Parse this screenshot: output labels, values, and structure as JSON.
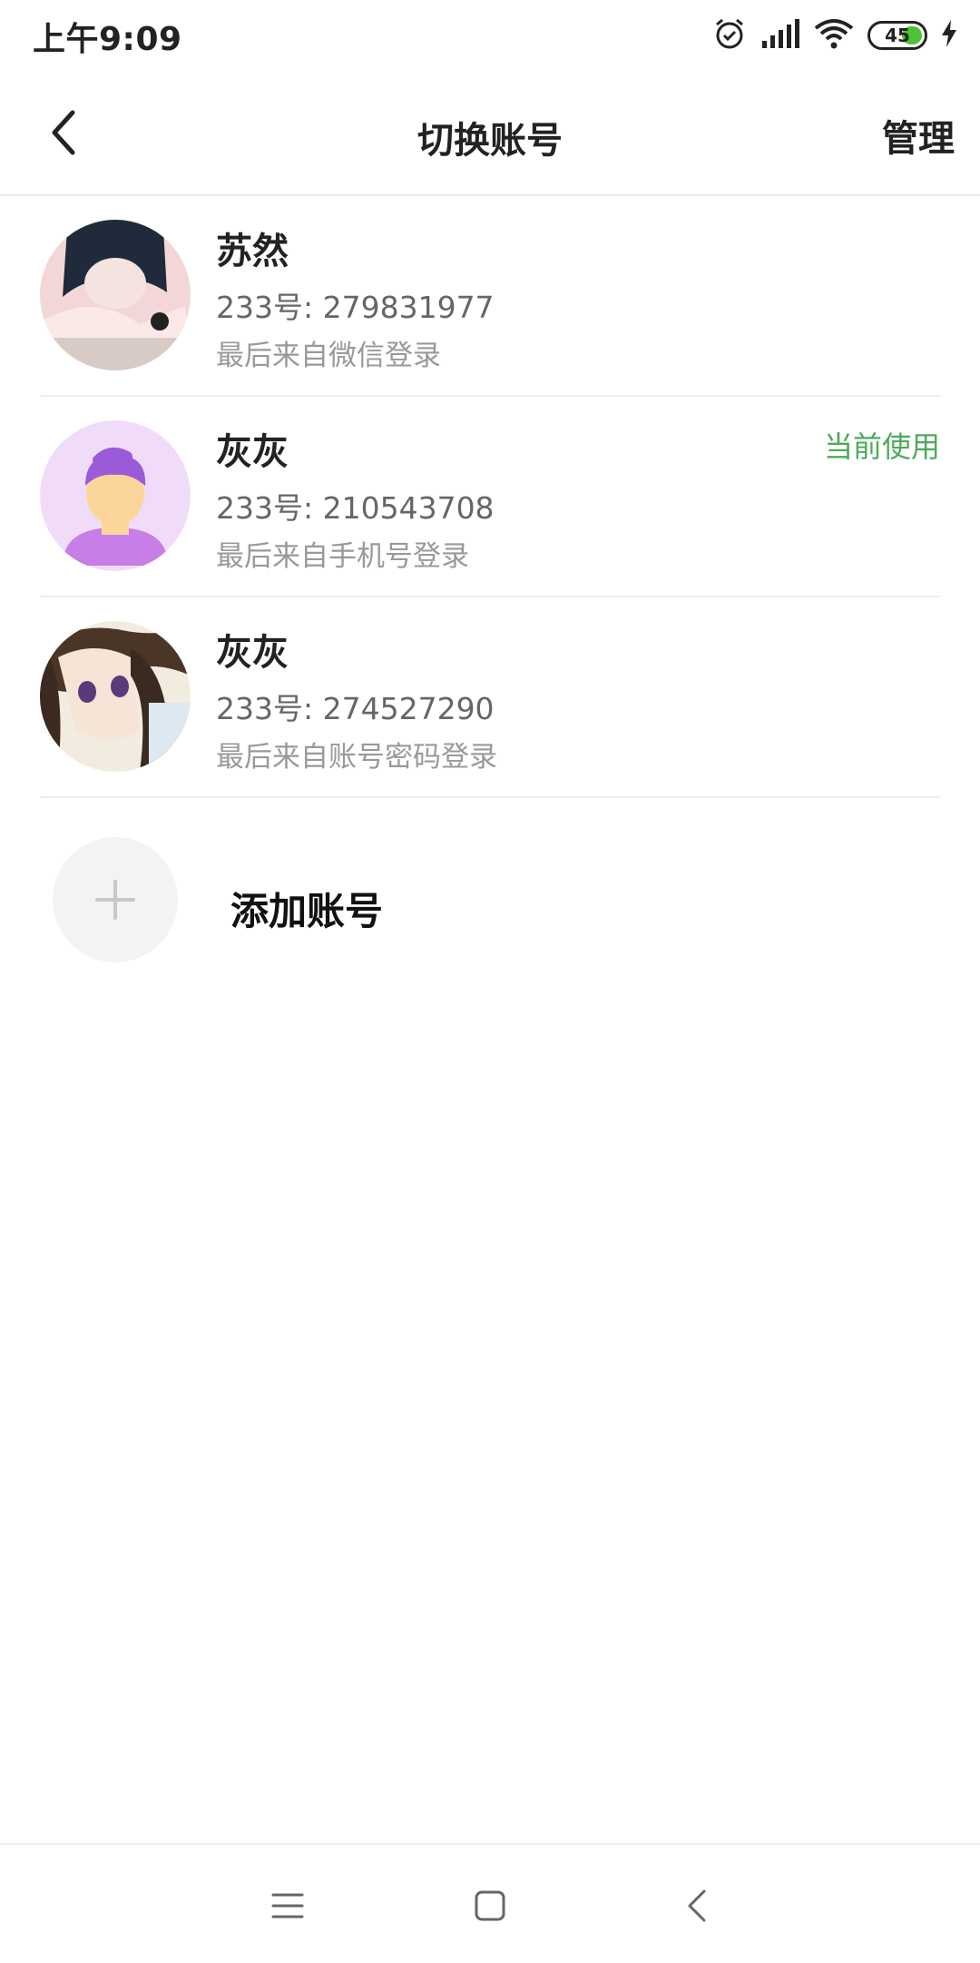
{
  "status_bar": {
    "time": "上午9:09",
    "battery_level": "45",
    "battery_color": "#4cc334",
    "icons": [
      "alarm-icon",
      "signal-icon",
      "wifi-icon",
      "battery-icon",
      "charging-icon"
    ]
  },
  "header": {
    "title": "切换账号",
    "manage_label": "管理",
    "back_icon": "back-arrow-icon"
  },
  "accounts": [
    {
      "name": "苏然",
      "id_text": "233号: 279831977",
      "login_text": "最后来自微信登录",
      "current_label": ""
    },
    {
      "name": "灰灰",
      "id_text": "233号: 210543708",
      "login_text": "最后来自手机号登录",
      "current_label": "当前使用"
    },
    {
      "name": "灰灰",
      "id_text": "233号: 274527290",
      "login_text": "最后来自账号密码登录",
      "current_label": ""
    }
  ],
  "add_account": {
    "label": "添加账号",
    "icon": "plus-icon"
  },
  "nav_bar": {
    "icons": [
      "menu-icon",
      "home-icon",
      "back-icon"
    ]
  },
  "colors": {
    "current_accent": "#4caa5a",
    "divider": "#eeeeee"
  }
}
